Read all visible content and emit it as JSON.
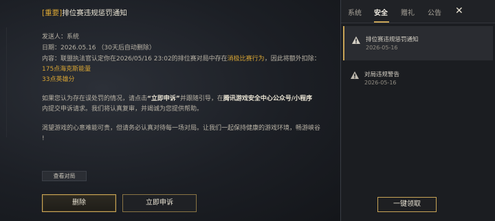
{
  "mail": {
    "title_tag": "[重要]",
    "title_text": "排位赛违规惩罚通知",
    "sender_line": "发送人：系统",
    "date_line": "日期：2026.05.16 （30天后自动删除）",
    "body_p1_a": "内容：联盟执法官认定你在2026/05/16 23:02的排位赛对局中存在",
    "body_p1_hl": "消极比赛行为",
    "body_p1_b": "，因此将额外扣除：",
    "penalty_1": "175点海克斯能量",
    "penalty_2": "33点英雄分",
    "body_p2_a": "如果您认为存在误处罚的情况，请点击",
    "body_p2_bold1": "“立即申诉”",
    "body_p2_b": "并跟随引导，在",
    "body_p2_bold2": "腾讯游戏安全中心公众号/小程序",
    "body_p2_c": "内提交申诉请求。我们将认真复审，并竭诚为您提供帮助。",
    "body_p3_line1": "渴望游戏的心意难能可贵，但请务必认真对待每一场对局。让我们一起保持健康的游戏环境，畅游峡谷",
    "body_p3_line2": "!",
    "view_battle_label": "查看对局",
    "delete_label": "删除",
    "appeal_label": "立即申诉"
  },
  "tabs": [
    {
      "label": "系统"
    },
    {
      "label": "安全"
    },
    {
      "label": "赠礼"
    },
    {
      "label": "公告"
    }
  ],
  "close_glyph": "✕",
  "inbox": [
    {
      "title": "排位赛违规惩罚通知",
      "date": "2026-05-16",
      "selected": true
    },
    {
      "title": "对局违规警告",
      "date": "2026-05-16",
      "selected": false
    }
  ],
  "claim_all_label": "一键领取",
  "colors": {
    "accent": "#c9a557",
    "highlight": "#d8a534"
  }
}
